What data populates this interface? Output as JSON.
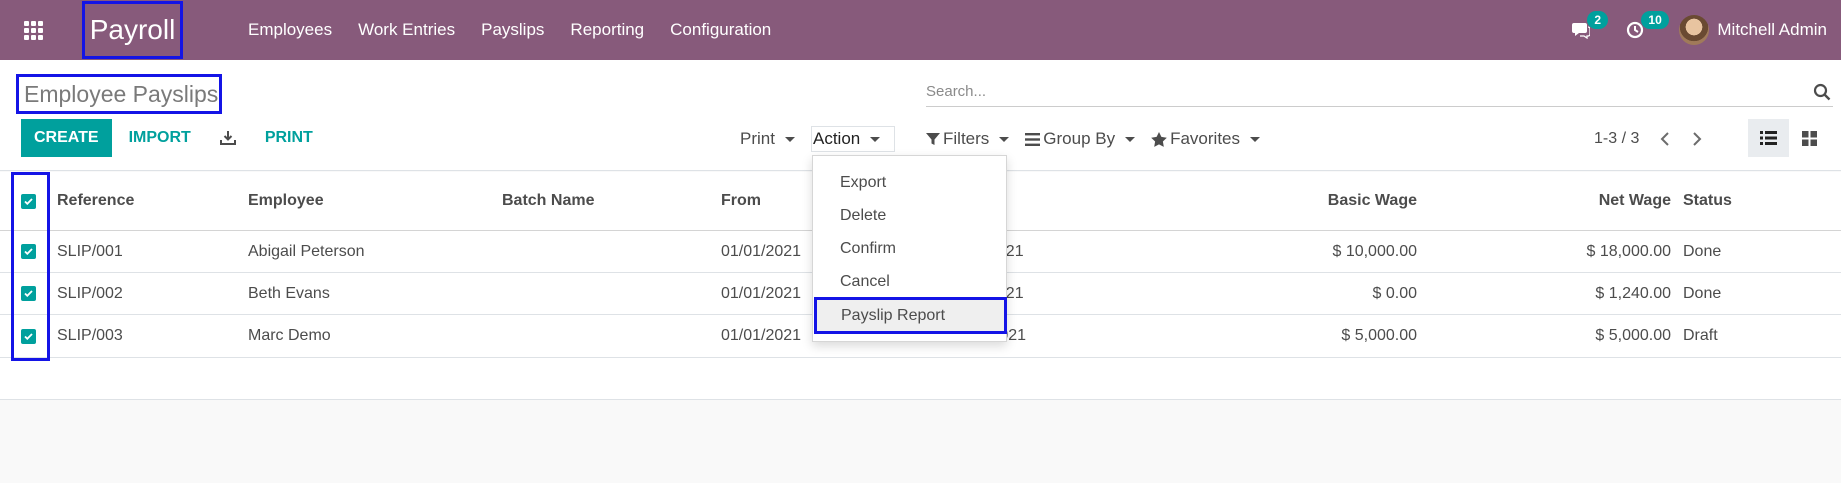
{
  "navbar": {
    "brand": "Payroll",
    "menu": [
      "Employees",
      "Work Entries",
      "Payslips",
      "Reporting",
      "Configuration"
    ],
    "messages_badge": "2",
    "activities_badge": "10",
    "user_name": "Mitchell Admin"
  },
  "control_panel": {
    "title": "Employee Payslips",
    "search_placeholder": "Search...",
    "create_label": "CREATE",
    "import_label": "IMPORT",
    "print_button_label": "PRINT",
    "print_dropdown_label": "Print",
    "action_dropdown_label": "Action",
    "filters_label": "Filters",
    "group_by_label": "Group By",
    "favorites_label": "Favorites",
    "pager_text": "1-3 / 3"
  },
  "list": {
    "columns": [
      "Reference",
      "Employee",
      "Batch Name",
      "From",
      "Basic Wage",
      "Net Wage",
      "Status"
    ],
    "rows": [
      {
        "reference": "SLIP/001",
        "employee": "Abigail Peterson",
        "batch": "",
        "from": "01/01/2021",
        "to": "2021",
        "basic_wage": "$ 10,000.00",
        "net_wage": "$ 18,000.00",
        "status": "Done"
      },
      {
        "reference": "SLIP/002",
        "employee": "Beth Evans",
        "batch": "",
        "from": "01/01/2021",
        "to": "2021",
        "basic_wage": "$ 0.00",
        "net_wage": "$ 1,240.00",
        "status": "Done"
      },
      {
        "reference": "SLIP/003",
        "employee": "Marc Demo",
        "batch": "",
        "from": "01/01/2021",
        "to": "01/31/2021",
        "basic_wage": "$ 5,000.00",
        "net_wage": "$ 5,000.00",
        "status": "Draft"
      }
    ]
  },
  "action_menu": {
    "items": [
      "Export",
      "Delete",
      "Confirm",
      "Cancel",
      "Payslip Report"
    ],
    "highlighted": "Payslip Report"
  },
  "colors": {
    "navbar": "#875a7b",
    "accent": "#00a09d",
    "annotation_box": "#1414e6"
  }
}
